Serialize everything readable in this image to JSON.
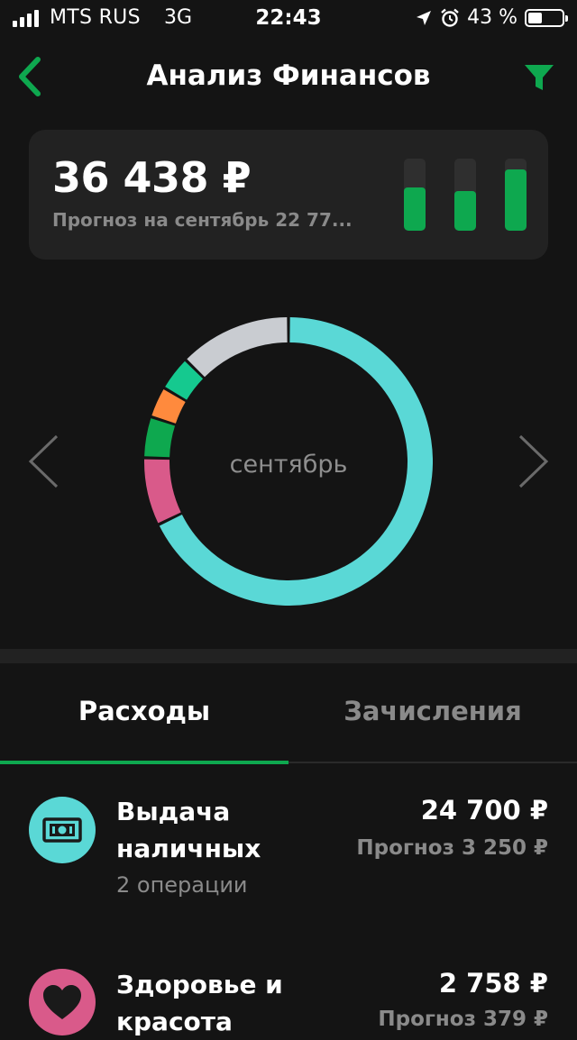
{
  "status_bar": {
    "carrier": "MTS RUS",
    "network": "3G",
    "time": "22:43",
    "battery": "43 %",
    "battery_level": 0.43
  },
  "header": {
    "title": "Анализ Финансов",
    "back_icon": "chevron-left-icon",
    "filter_icon": "filter-icon"
  },
  "summary": {
    "amount": "36 438 ₽",
    "forecast": "Прогноз на сентябрь 22 77...",
    "bars": [
      0.6,
      0.55,
      0.85
    ]
  },
  "chart": {
    "month_label": "сентябрь"
  },
  "chart_data": {
    "type": "pie",
    "center_label": "сентябрь",
    "slices": [
      {
        "value": 67.8,
        "color": "#5ad8d6"
      },
      {
        "value": 7.6,
        "color": "#d95a8a"
      },
      {
        "value": 4.6,
        "color": "#0ea84f"
      },
      {
        "value": 3.5,
        "color": "#ff8a3d"
      },
      {
        "value": 3.9,
        "color": "#15c98f"
      },
      {
        "value": 12.6,
        "color": "#c9ccd1"
      }
    ]
  },
  "tabs": [
    {
      "label": "Расходы",
      "active": true
    },
    {
      "label": "Зачисления",
      "active": false
    }
  ],
  "items": [
    {
      "name_line1": "Выдача",
      "name_line2": "наличных",
      "sub": "2 операции",
      "amount": "24 700 ₽",
      "forecast": "Прогноз 3 250 ₽",
      "color": "#5ad8d6",
      "icon": "cash-icon"
    },
    {
      "name_line1": "Здоровье и",
      "name_line2": "красота",
      "sub": "",
      "amount": "2 758 ₽",
      "forecast": "Прогноз 379 ₽",
      "color": "#d95a8a",
      "icon": "heart-icon"
    }
  ],
  "colors": {
    "accent": "#0ea84f",
    "background": "#141414",
    "card": "#222222"
  }
}
